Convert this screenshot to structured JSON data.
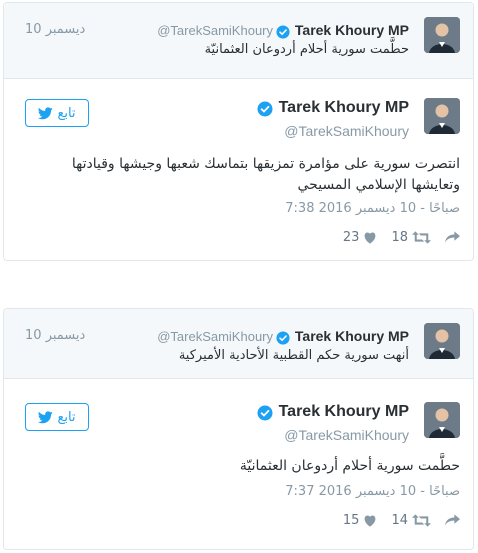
{
  "colors": {
    "accent": "#1da1f2",
    "verified": "#1da1f2",
    "muted": "#8899a6"
  },
  "tweets": [
    {
      "quoted": {
        "name": "Tarek Khoury MP",
        "handle": "@TarekSamiKhoury",
        "date": "10 ديسمبر",
        "text": "حطَّمت سورية أحلام أردوعان العثمانيّة"
      },
      "author": {
        "name": "Tarek Khoury MP",
        "handle": "@TarekSamiKhoury"
      },
      "follow_label": "تابع",
      "text": "انتصرت سورية على مؤامرة تمزيقها بتماسك شعبها وجيشها وقيادتها وتعايشها الإسلامي المسيحي",
      "timestamp": "7:38 صباحًا - 10 ديسمبر 2016",
      "retweets": "18",
      "likes": "23"
    },
    {
      "quoted": {
        "name": "Tarek Khoury MP",
        "handle": "@TarekSamiKhoury",
        "date": "10 ديسمبر",
        "text": "أنهت سورية حكم القطبية الأحادية الأميركية"
      },
      "author": {
        "name": "Tarek Khoury MP",
        "handle": "@TarekSamiKhoury"
      },
      "follow_label": "تابع",
      "text": "حطَّمت سورية أحلام أردوعان العثمانيّة",
      "timestamp": "7:37 صباحًا - 10 ديسمبر 2016",
      "retweets": "14",
      "likes": "15"
    }
  ]
}
